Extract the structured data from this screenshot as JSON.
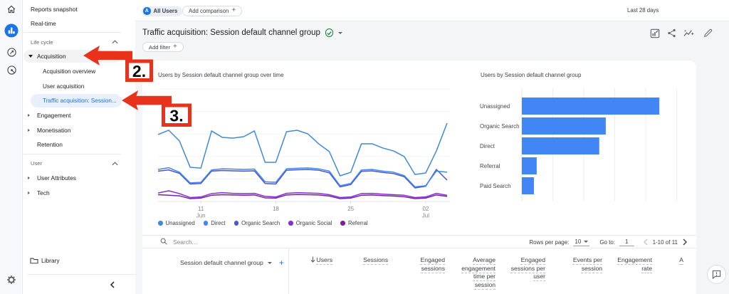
{
  "rail": {
    "icons": [
      "home",
      "reports",
      "explore",
      "advertising",
      "settings"
    ]
  },
  "nav": {
    "reports_snapshot": "Reports snapshot",
    "real_time": "Real-time",
    "life_cycle": "Life cycle",
    "acquisition": "Acquisition",
    "acquisition_overview": "Acquisition overview",
    "user_acquisition": "User acquisition",
    "traffic_acquisition": "Traffic acquisition: Session...",
    "engagement": "Engagement",
    "monetisation": "Monetisation",
    "retention": "Retention",
    "user_section": "User",
    "user_attributes": "User Attributes",
    "tech": "Tech",
    "library": "Library"
  },
  "topbar": {
    "avatar_letter": "A",
    "all_users": "All Users",
    "add_comparison": "Add comparison",
    "date_range": "Last 28 days"
  },
  "header": {
    "title": "Traffic acquisition: Session default channel group",
    "add_filter": "Add filter"
  },
  "annotations": {
    "step2": "2.",
    "step3": "3."
  },
  "chart_data": [
    {
      "type": "line",
      "title": "Users by Session default channel group over time",
      "x_axis": {
        "tick_indices": [
          4,
          11,
          18,
          25
        ],
        "tick_labels": [
          [
            "11",
            "Jun"
          ],
          [
            "18"
          ],
          [
            "25"
          ],
          [
            "02",
            "Jul"
          ]
        ]
      },
      "ylim": [
        0,
        1000
      ],
      "series": [
        {
          "name": "Unassigned",
          "color": "#4189d6",
          "values": [
            595,
            633,
            538,
            304,
            297,
            627,
            570,
            563,
            576,
            627,
            348,
            348,
            620,
            633,
            601,
            513,
            443,
            228,
            259,
            513,
            513,
            475,
            449,
            399,
            240,
            253,
            449,
            696
          ]
        },
        {
          "name": "Direct",
          "color": "#4285f4",
          "values": [
            285,
            300,
            260,
            165,
            170,
            280,
            290,
            288,
            285,
            288,
            175,
            170,
            290,
            295,
            298,
            290,
            270,
            140,
            160,
            280,
            285,
            270,
            260,
            230,
            130,
            140,
            270,
            260
          ]
        },
        {
          "name": "Organic Search",
          "color": "#4a58c9",
          "values": [
            270,
            280,
            250,
            155,
            160,
            270,
            275,
            272,
            270,
            272,
            160,
            155,
            278,
            282,
            285,
            278,
            255,
            130,
            150,
            268,
            272,
            258,
            248,
            220,
            120,
            135,
            285,
            190
          ]
        },
        {
          "name": "Organic Social",
          "color": "#8430ce",
          "values": [
            75,
            95,
            70,
            35,
            40,
            70,
            78,
            72,
            70,
            72,
            45,
            40,
            72,
            78,
            75,
            72,
            60,
            35,
            40,
            70,
            72,
            65,
            60,
            55,
            35,
            40,
            72,
            55
          ]
        },
        {
          "name": "Referral",
          "color": "#7b1fa2",
          "values": [
            60,
            55,
            50,
            25,
            30,
            55,
            60,
            58,
            55,
            58,
            32,
            30,
            58,
            62,
            60,
            58,
            48,
            25,
            30,
            55,
            58,
            52,
            48,
            42,
            25,
            30,
            58,
            45
          ]
        }
      ]
    },
    {
      "type": "bar",
      "title": "Users by Session default channel group",
      "categories": [
        "Unassigned",
        "Organic Search",
        "Direct",
        "Referral",
        "Paid Search"
      ],
      "values": [
        4440,
        2710,
        2500,
        480,
        390
      ],
      "xlim": [
        0,
        5000
      ],
      "bar_color": "#4285f4"
    }
  ],
  "table": {
    "search_placeholder": "Search...",
    "rows_per_page_label": "Rows per page:",
    "rows_per_page_value": "10",
    "goto_label": "Go to:",
    "goto_value": "1",
    "pagination_range": "1-10 of 11",
    "dimension_header": "Session default channel group",
    "metric_headers": [
      "Users",
      "Sessions",
      "Engaged sessions",
      "Average engagement time per session",
      "Engaged sessions per user",
      "Events per session",
      "Engagement rate",
      "A"
    ],
    "sorted_column": "Users"
  }
}
